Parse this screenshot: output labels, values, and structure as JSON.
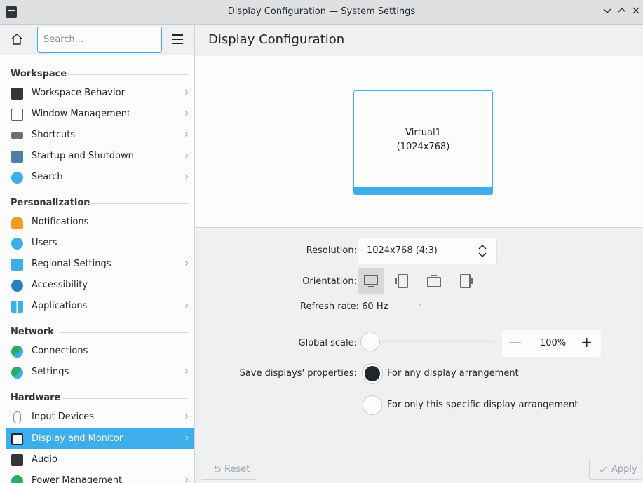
{
  "window": {
    "title": "Display Configuration — System Settings"
  },
  "sidebar": {
    "search_placeholder": "Search...",
    "sections": [
      {
        "title": "Workspace",
        "items": [
          {
            "label": "Workspace Behavior",
            "has_children": true
          },
          {
            "label": "Window Management",
            "has_children": true
          },
          {
            "label": "Shortcuts",
            "has_children": true
          },
          {
            "label": "Startup and Shutdown",
            "has_children": true
          },
          {
            "label": "Search",
            "has_children": true
          }
        ]
      },
      {
        "title": "Personalization",
        "items": [
          {
            "label": "Notifications",
            "has_children": false
          },
          {
            "label": "Users",
            "has_children": false
          },
          {
            "label": "Regional Settings",
            "has_children": true
          },
          {
            "label": "Accessibility",
            "has_children": false
          },
          {
            "label": "Applications",
            "has_children": true
          }
        ]
      },
      {
        "title": "Network",
        "items": [
          {
            "label": "Connections",
            "has_children": false
          },
          {
            "label": "Settings",
            "has_children": true
          }
        ]
      },
      {
        "title": "Hardware",
        "items": [
          {
            "label": "Input Devices",
            "has_children": true
          },
          {
            "label": "Display and Monitor",
            "has_children": true,
            "active": true
          },
          {
            "label": "Audio",
            "has_children": false
          },
          {
            "label": "Power Management",
            "has_children": true
          }
        ]
      }
    ]
  },
  "main": {
    "title": "Display Configuration",
    "monitor": {
      "name": "Virtual1",
      "resolution": "(1024x768)"
    },
    "resolution": {
      "label": "Resolution:",
      "value": "1024x768 (4:3)"
    },
    "orientation": {
      "label": "Orientation:",
      "selected_index": 0
    },
    "refresh_rate": "Refresh rate: 60 Hz",
    "global_scale": {
      "label": "Global scale:",
      "value": "100%",
      "minus": "—",
      "plus": "+",
      "level": 0.0
    },
    "save_properties": {
      "label": "Save displays' properties:",
      "options": [
        "For any display arrangement",
        "For only this specific display arrangement"
      ],
      "selected_index": 0
    },
    "buttons": {
      "reset": "Reset",
      "apply": "Apply"
    }
  },
  "colors": {
    "accent": "#3daee9",
    "background": "#eff0f1",
    "surface": "#fcfcfc",
    "text": "#232629"
  }
}
